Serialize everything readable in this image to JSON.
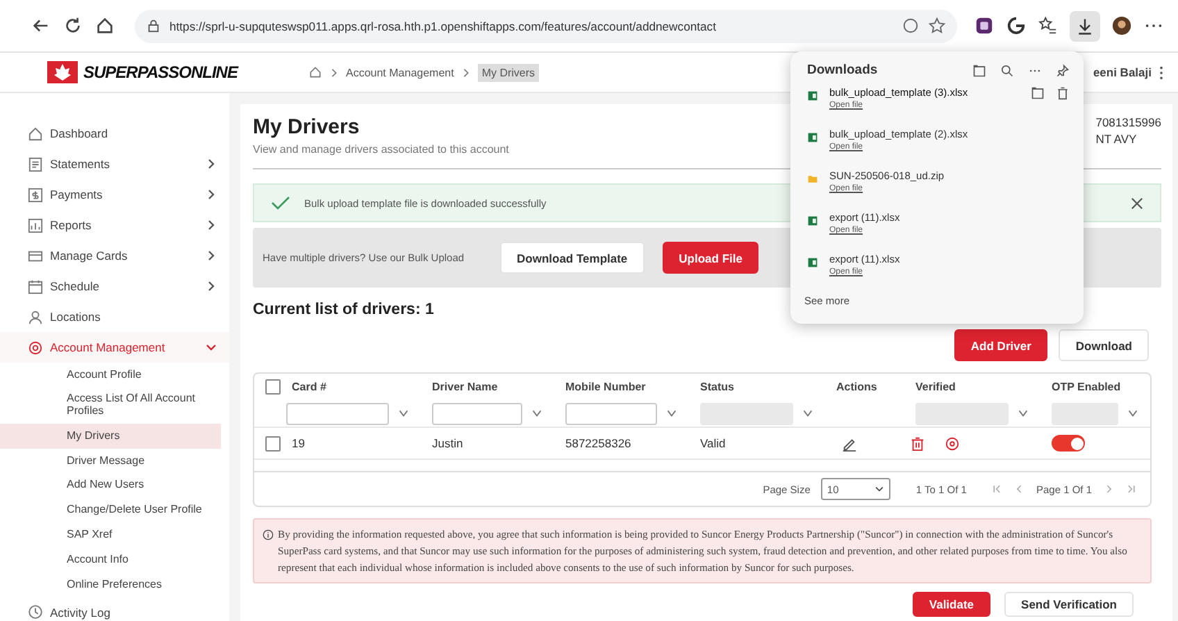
{
  "browser": {
    "url": "https://sprl-u-supquteswsp011.apps.qrl-rosa.hth.p1.openshiftapps.com/features/account/addnewcontact"
  },
  "header": {
    "logo_text": "SUPERPASSONLINE",
    "breadcrumb": [
      {
        "label": "Account Management",
        "selected": false
      },
      {
        "label": "My Drivers",
        "selected": true
      }
    ],
    "user_name": "eeni Balaji"
  },
  "sidebar": {
    "items": [
      {
        "label": "Dashboard",
        "selected": false
      },
      {
        "label": "Statements",
        "selected": false,
        "expanded": false
      },
      {
        "label": "Payments",
        "selected": false,
        "expanded": false
      },
      {
        "label": "Reports",
        "selected": false,
        "expanded": false
      },
      {
        "label": "Manage Cards",
        "selected": false,
        "expanded": false
      },
      {
        "label": "Schedule",
        "selected": false,
        "expanded": false
      },
      {
        "label": "Locations",
        "selected": false
      },
      {
        "label": "Account Management",
        "selected": true,
        "expanded": true,
        "children": [
          {
            "label": "Account Profile",
            "selected": false
          },
          {
            "label": "Access List Of All Account Profiles",
            "selected": false
          },
          {
            "label": "My Drivers",
            "selected": true
          },
          {
            "label": "Driver Message",
            "selected": false
          },
          {
            "label": "Add New Users",
            "selected": false
          },
          {
            "label": "Change/Delete User Profile",
            "selected": false
          },
          {
            "label": "SAP Xref",
            "selected": false
          },
          {
            "label": "Account Info",
            "selected": false
          },
          {
            "label": "Online Preferences",
            "selected": false
          }
        ]
      },
      {
        "label": "Activity Log",
        "selected": false
      }
    ]
  },
  "page": {
    "title": "My Drivers",
    "subtitle": "View and manage drivers associated to this account",
    "account_number": "7081315996",
    "account_name": "NT AVY",
    "alert": "Bulk upload template file is downloaded successfully",
    "bulk_text": "Have multiple drivers? Use our Bulk Upload",
    "bulk_buttons": [
      {
        "label": "Download Template",
        "kind": "secondary"
      },
      {
        "label": "Upload File",
        "kind": "primary"
      }
    ],
    "list_heading": "Current list of drivers: 1",
    "list_buttons": [
      {
        "label": "Add Driver",
        "kind": "primary"
      },
      {
        "label": "Download",
        "kind": "secondary"
      }
    ]
  },
  "table": {
    "all_checked": false,
    "columns": [
      {
        "label": "Card #",
        "kind": "text"
      },
      {
        "label": "Driver Name",
        "kind": "text"
      },
      {
        "label": "Mobile Number",
        "kind": "text"
      },
      {
        "label": "Status",
        "kind": "select"
      },
      {
        "label": "Actions",
        "kind": "none"
      },
      {
        "label": "Verified",
        "kind": "select"
      },
      {
        "label": "OTP Enabled",
        "kind": "select"
      }
    ],
    "rows": [
      {
        "checked": false,
        "card": "19",
        "driver_name": "Justin",
        "mobile": "5872258326",
        "status": "Valid",
        "otp_enabled": true
      }
    ],
    "pagination": {
      "page_size_label": "Page Size",
      "page_size": "10",
      "range": "1 To 1 Of 1",
      "page": "Page 1 Of 1"
    }
  },
  "disclaimer": "By providing the information requested above, you agree that such information is being provided to Suncor Energy Products Partnership (\"Suncor\") in connection with the administration of Suncor's SuperPass card systems, and that Suncor may use such information for the purposes of administering such system, fraud detection and prevention, and other related purposes from time to time. You also represent that each individual whose information is included above consents to the use of such information by Suncor for such purposes.",
  "footer_buttons": [
    {
      "label": "Validate",
      "kind": "primary"
    },
    {
      "label": "Send Verification",
      "kind": "secondary"
    }
  ],
  "downloads": {
    "title": "Downloads",
    "items": [
      {
        "name": "bulk_upload_template (3).xlsx",
        "action": "Open file",
        "kind": "sheet",
        "hovered": true
      },
      {
        "name": "bulk_upload_template (2).xlsx",
        "action": "Open file",
        "kind": "sheet",
        "hovered": false
      },
      {
        "name": "SUN-250506-018_ud.zip",
        "action": "Open file",
        "kind": "folder",
        "hovered": false
      },
      {
        "name": "export (11).xlsx",
        "action": "Open file",
        "kind": "sheet",
        "hovered": false
      },
      {
        "name": "export (11).xlsx",
        "action": "Open file",
        "kind": "sheet",
        "hovered": false
      }
    ],
    "see_more": "See more"
  }
}
